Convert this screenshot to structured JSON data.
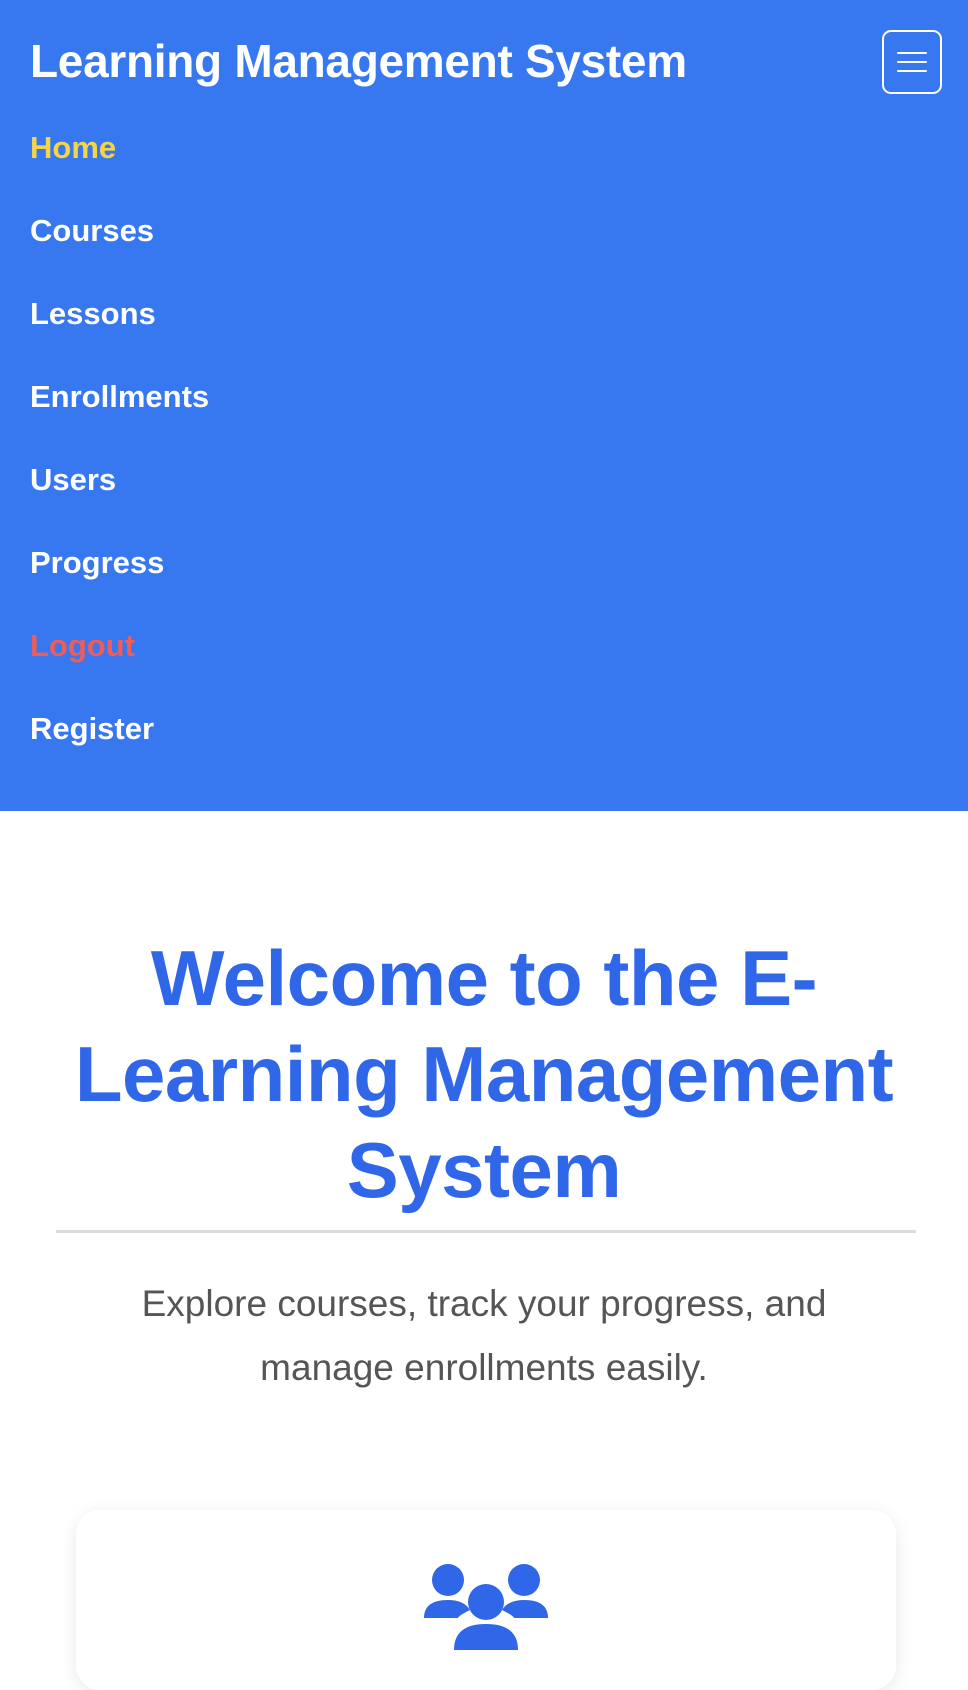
{
  "navbar": {
    "brand": "Learning Management System",
    "toggle_icon": "hamburger-menu-icon",
    "items": [
      {
        "label": "Home",
        "state": "active",
        "color": "#f5d547"
      },
      {
        "label": "Courses"
      },
      {
        "label": "Lessons"
      },
      {
        "label": "Enrollments"
      },
      {
        "label": "Users"
      },
      {
        "label": "Progress"
      },
      {
        "label": "Logout",
        "color": "#ee5d57"
      },
      {
        "label": "Register"
      }
    ]
  },
  "hero": {
    "title": "Welcome to the E-Learning Management System",
    "subtitle": "Explore courses, track your progress, and manage enrollments easily."
  },
  "feature_card": {
    "icon": "users-group-icon"
  },
  "colors": {
    "navbar_bg": "#3777f0",
    "title": "#3066e8",
    "active_link": "#f5d547",
    "logout_link": "#ee5d57",
    "subtitle": "#555555"
  }
}
